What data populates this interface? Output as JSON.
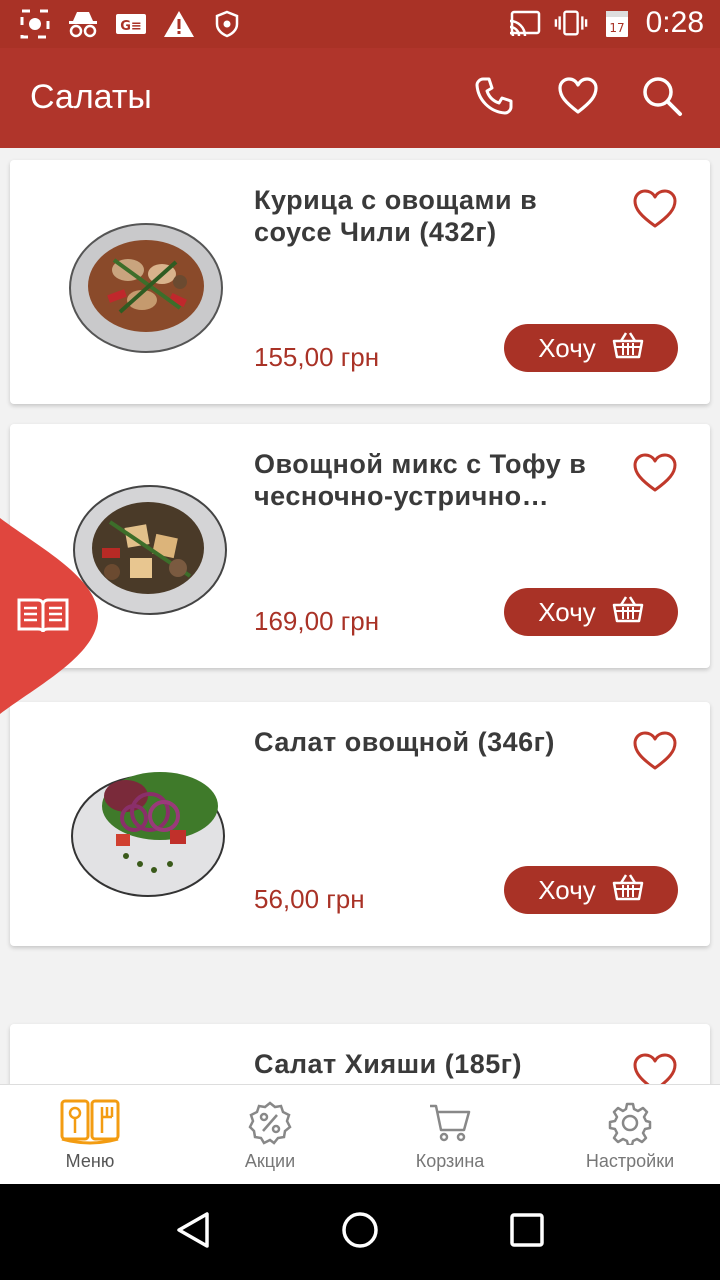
{
  "status_bar": {
    "time": "0:28",
    "calendar_day": "17",
    "left_icons": [
      "screenshot-icon",
      "incognito-icon",
      "sim-card-icon",
      "warning-icon",
      "shield-icon"
    ],
    "right_icons": [
      "cast-icon",
      "vibrate-icon",
      "calendar-icon"
    ]
  },
  "appbar": {
    "title": "Салаты",
    "actions": [
      "phone-icon",
      "favorites-icon",
      "search-icon"
    ]
  },
  "products": [
    {
      "name": "Курица с овощами в соусе Чили  (432г)",
      "price": "155,00 грн",
      "button": "Хочу"
    },
    {
      "name": "Овощной микс с Тофу в чесночно-устрично…",
      "price": "169,00 грн",
      "button": "Хочу"
    },
    {
      "name": "Салат овощной (346г)",
      "price": "56,00 грн",
      "button": "Хочу"
    },
    {
      "name": "Салат Хияши (185г)",
      "price": "",
      "button": ""
    }
  ],
  "tabs": [
    {
      "label": "Меню",
      "icon": "menu-book-icon",
      "active": true
    },
    {
      "label": "Акции",
      "icon": "percent-badge-icon",
      "active": false
    },
    {
      "label": "Корзина",
      "icon": "cart-icon",
      "active": false
    },
    {
      "label": "Настройки",
      "icon": "settings-gear-icon",
      "active": false
    }
  ],
  "colors": {
    "brand": "#b0352b",
    "price": "#a93226",
    "active_tab": "#f39c12"
  }
}
